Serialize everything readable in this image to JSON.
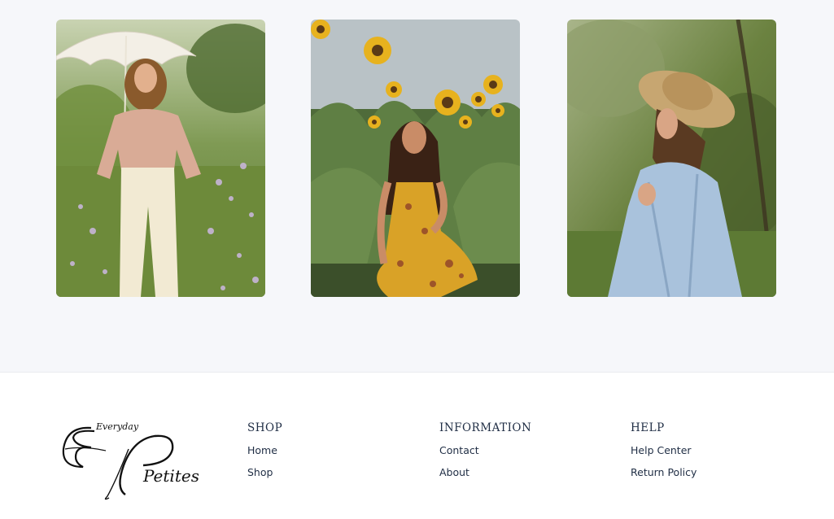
{
  "gallery": {
    "photos": [
      {
        "icon": "woman-with-lace-parasol-photo"
      },
      {
        "icon": "woman-in-sunflower-field-photo"
      },
      {
        "icon": "woman-in-straw-hat-photo"
      }
    ]
  },
  "footer": {
    "logo": {
      "line1": "Everyday",
      "line2": "Petites"
    },
    "shop": {
      "heading": "SHOP",
      "links": [
        "Home",
        "Shop"
      ]
    },
    "information": {
      "heading": "INFORMATION",
      "links": [
        "Contact",
        "About"
      ]
    },
    "help": {
      "heading": "HELP",
      "links": [
        "Help Center",
        "Return Policy"
      ]
    }
  },
  "colors": {
    "gallery_bg": "#f6f7fa",
    "footer_text": "#1f2d44",
    "logo_ink": "#111111"
  }
}
